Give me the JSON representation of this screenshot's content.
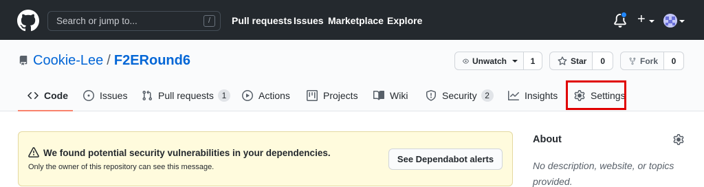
{
  "header": {
    "search_placeholder": "Search or jump to...",
    "search_shortcut": "/",
    "nav": [
      "Pull requests",
      "Issues",
      "Marketplace",
      "Explore"
    ],
    "plus_label": "+",
    "notification_dot_color": "#2188ff"
  },
  "repo": {
    "owner": "Cookie-Lee",
    "separator": "/",
    "name": "F2ERound6",
    "watch": {
      "label": "Unwatch",
      "count": "1"
    },
    "star": {
      "label": "Star",
      "count": "0"
    },
    "fork": {
      "label": "Fork",
      "count": "0"
    }
  },
  "tabs": [
    {
      "label": "Code",
      "icon": "code-icon",
      "active": true
    },
    {
      "label": "Issues",
      "icon": "issue-icon"
    },
    {
      "label": "Pull requests",
      "icon": "pull-request-icon",
      "counter": "1"
    },
    {
      "label": "Actions",
      "icon": "play-icon"
    },
    {
      "label": "Projects",
      "icon": "project-icon"
    },
    {
      "label": "Wiki",
      "icon": "book-icon"
    },
    {
      "label": "Security",
      "icon": "shield-icon",
      "counter": "2"
    },
    {
      "label": "Insights",
      "icon": "graph-icon"
    },
    {
      "label": "Settings",
      "icon": "gear-icon",
      "highlighted": true
    }
  ],
  "flash": {
    "title": "We found potential security vulnerabilities in your dependencies.",
    "subtitle": "Only the owner of this repository can see this message.",
    "button": "See Dependabot alerts"
  },
  "about": {
    "title": "About",
    "description": "No description, website, or topics provided."
  },
  "colors": {
    "header_bg": "#24292e",
    "link": "#0366d6",
    "active_tab_underline": "#f9826c",
    "highlight_box": "#e00000",
    "flash_bg": "#fffbdd"
  }
}
